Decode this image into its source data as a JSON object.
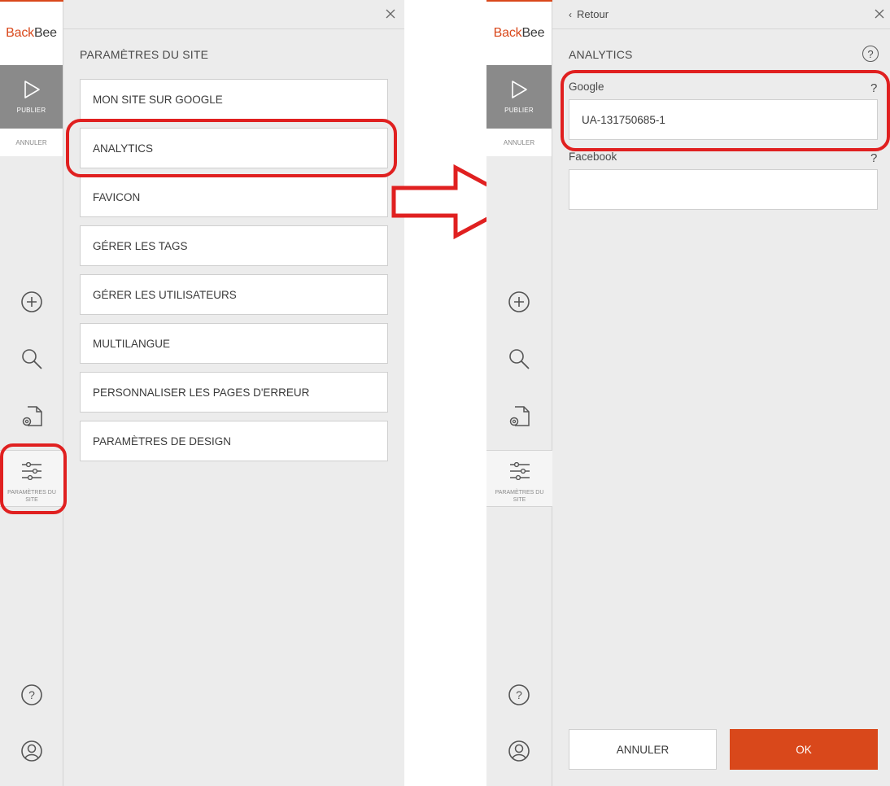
{
  "brand": {
    "part1": "Back",
    "part2": "Bee",
    "accent": "#d9481b"
  },
  "rail": {
    "publish_label": "PUBLIER",
    "cancel_label": "ANNULER",
    "settings_label": "PARAMÈTRES DU SITE",
    "icons": [
      "plus-circle-icon",
      "search-icon",
      "file-settings-icon",
      "sliders-icon",
      "help-icon",
      "user-icon"
    ]
  },
  "settings_panel": {
    "title": "PARAMÈTRES DU SITE",
    "items": [
      {
        "label": "MON SITE SUR GOOGLE"
      },
      {
        "label": "ANALYTICS"
      },
      {
        "label": "FAVICON"
      },
      {
        "label": "GÉRER LES TAGS"
      },
      {
        "label": "GÉRER LES UTILISATEURS"
      },
      {
        "label": "MULTILANGUE"
      },
      {
        "label": "PERSONNALISER LES PAGES D'ERREUR"
      },
      {
        "label": "PARAMÈTRES DE DESIGN"
      }
    ]
  },
  "analytics_panel": {
    "back_label": "Retour",
    "title": "ANALYTICS",
    "help_glyph": "?",
    "google": {
      "label": "Google",
      "value": "UA-131750685-1",
      "help": "?"
    },
    "facebook": {
      "label": "Facebook",
      "value": "",
      "help": "?"
    },
    "cancel_label": "ANNULER",
    "ok_label": "OK"
  },
  "highlight_color": "#e02020"
}
